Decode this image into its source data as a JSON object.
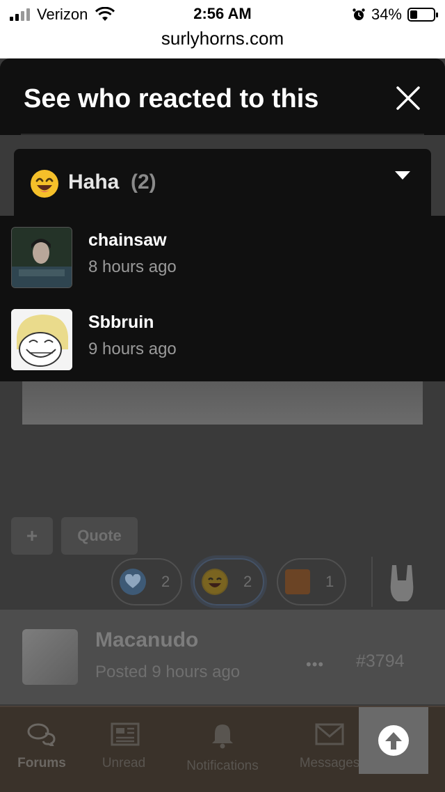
{
  "status": {
    "carrier": "Verizon",
    "time": "2:56 AM",
    "battery": "34%",
    "battery_level": 0.34,
    "url": "surlyhorns.com"
  },
  "modal": {
    "title": "See who reacted to this",
    "tab": {
      "reaction": "Haha",
      "count": "(2)"
    },
    "users": [
      {
        "name": "chainsaw",
        "time": "8 hours ago"
      },
      {
        "name": "Sbbruin",
        "time": "9 hours ago"
      }
    ]
  },
  "post": {
    "add_label": "+",
    "quote_label": "Quote",
    "reactions": [
      {
        "icon": "heart-icon",
        "count": "2"
      },
      {
        "icon": "haha-icon",
        "count": "2"
      },
      {
        "icon": "gritty-icon",
        "count": "1"
      }
    ],
    "next_author": "Macanudo",
    "next_posted": "Posted 9 hours ago",
    "more": "•••",
    "next_number": "#3794"
  },
  "nav": {
    "forums": "Forums",
    "unread": "Unread",
    "notifications": "Notifications",
    "messages": "Messages"
  },
  "colors": {
    "modal_bg": "#101010",
    "accent_heart": "#3e5a76",
    "haha_yellow": "#f5c02a"
  }
}
